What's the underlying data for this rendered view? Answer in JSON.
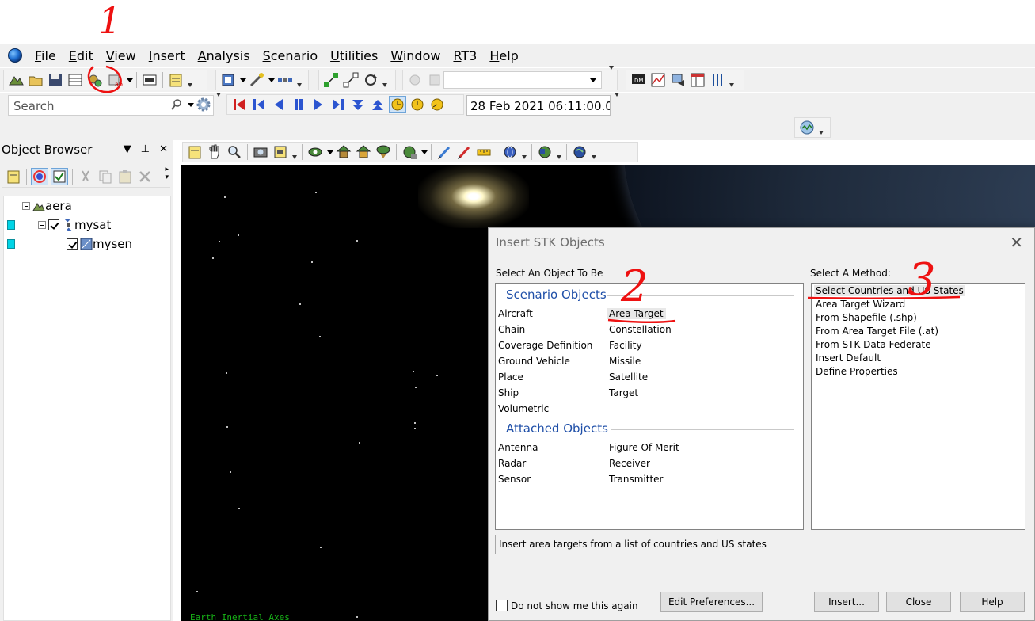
{
  "menu": {
    "items": [
      {
        "key": "F",
        "rest": "ile"
      },
      {
        "key": "E",
        "rest": "dit"
      },
      {
        "key": "V",
        "rest": "iew"
      },
      {
        "key": "I",
        "rest": "nsert"
      },
      {
        "key": "A",
        "rest": "nalysis"
      },
      {
        "key": "S",
        "rest": "cenario"
      },
      {
        "key": "U",
        "rest": "tilities"
      },
      {
        "key": "W",
        "rest": "indow"
      },
      {
        "key": "R",
        "rest": "T3"
      },
      {
        "key": "H",
        "rest": "elp"
      }
    ]
  },
  "toolbar": {
    "search_placeholder": "Search",
    "date_value": "28 Feb 2021 06:11:00.00"
  },
  "object_browser": {
    "title": "Object Browser",
    "tree": [
      {
        "label": "aera"
      },
      {
        "label": "mysat"
      },
      {
        "label": "mysen"
      }
    ]
  },
  "view3d": {
    "label": "Earth Inertial Axes"
  },
  "dialog": {
    "title": "Insert STK Objects",
    "object_label": "Select An Object To Be",
    "method_label": "Select A Method:",
    "scenario_header": "Scenario Objects",
    "attached_header": "Attached Objects",
    "scenario_col1": [
      "Aircraft",
      "Chain",
      "Coverage Definition",
      "Ground Vehicle",
      "Place",
      "Ship",
      "Volumetric"
    ],
    "scenario_col2": [
      "Area Target",
      "Constellation",
      "Facility",
      "Missile",
      "Satellite",
      "Target"
    ],
    "attached_col1": [
      "Antenna",
      "Radar",
      "Sensor"
    ],
    "attached_col2": [
      "Figure Of Merit",
      "Receiver",
      "Transmitter"
    ],
    "methods": [
      "Select Countries and US States",
      "Area Target Wizard",
      "From Shapefile (.shp)",
      "From Area Target File (.at)",
      "From STK Data Federate",
      "Insert Default",
      "Define Properties"
    ],
    "description": "Insert area targets from a list of countries and US states",
    "dont_show": "Do not show me this again",
    "btn_prefs": "Edit Preferences...",
    "btn_insert": "Insert...",
    "btn_close": "Close",
    "btn_help": "Help"
  },
  "annotations": [
    "1",
    "2",
    "3"
  ]
}
